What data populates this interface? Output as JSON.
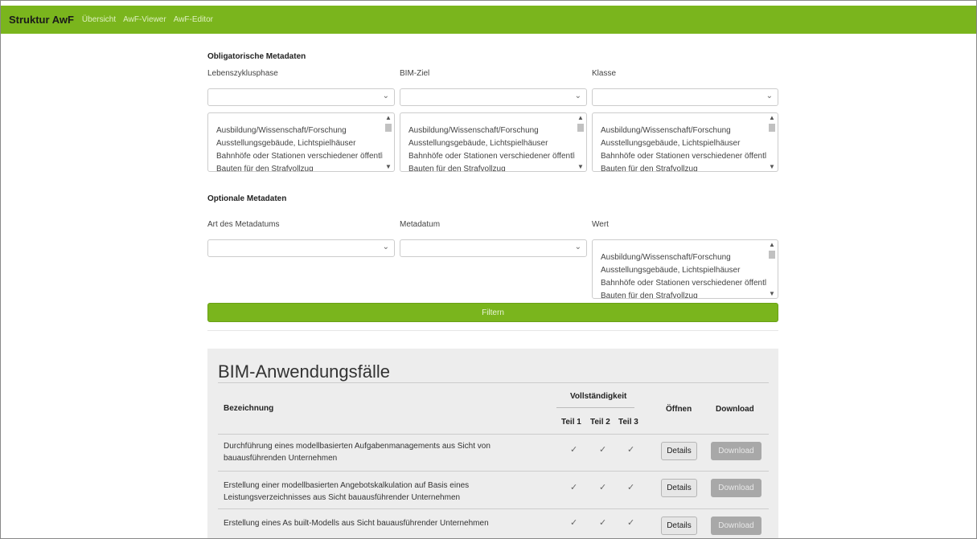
{
  "navbar": {
    "brand": "Struktur AwF",
    "links": [
      "Übersicht",
      "AwF-Viewer",
      "AwF-Editor"
    ]
  },
  "mandatory": {
    "heading": "Obligatorische Metadaten",
    "columns": [
      {
        "label": "Lebenszyklusphase",
        "select_value": ""
      },
      {
        "label": "BIM-Ziel",
        "select_value": ""
      },
      {
        "label": "Klasse",
        "select_value": ""
      }
    ]
  },
  "listbox_options": [
    "Ausbildung/Wissenschaft/Forschung",
    "Ausstellungsgebäude, Lichtspielhäuser",
    "Bahnhöfe oder Stationen verschiedener öffentlicher",
    "Bauten für den Strafvollzug"
  ],
  "optional": {
    "heading": "Optionale Metadaten",
    "columns": [
      {
        "label": "Art des Metadatums",
        "select_value": ""
      },
      {
        "label": "Metadatum",
        "select_value": ""
      },
      {
        "label": "Wert"
      }
    ]
  },
  "filter_button": "Filtern",
  "usecases": {
    "title": "BIM-Anwendungsfälle",
    "headers": {
      "name": "Bezeichnung",
      "completeness": "Vollständigkeit",
      "parts": [
        "Teil 1",
        "Teil 2",
        "Teil 3"
      ],
      "open": "Öffnen",
      "download": "Download"
    },
    "rows": [
      {
        "name": "Durchführung eines modellbasierten Aufgabenmanagements aus Sicht von bauausführenden Unternehmen",
        "checks": [
          "✓",
          "✓",
          "✓"
        ],
        "details": "Details",
        "download": "Download"
      },
      {
        "name": "Erstellung einer modellbasierten Angebotskalkulation auf Basis eines Leistungsverzeichnisses aus Sicht bauausführender Unternehmen",
        "checks": [
          "✓",
          "✓",
          "✓"
        ],
        "details": "Details",
        "download": "Download"
      },
      {
        "name": "Erstellung eines As built-Modells aus Sicht bauausführender Unternehmen",
        "checks": [
          "✓",
          "✓",
          "✓"
        ],
        "details": "Details",
        "download": "Download"
      }
    ]
  },
  "colors": {
    "accent": "#7ab51d",
    "panel_bg": "#ededed",
    "download_disabled": "#a8a8a8"
  },
  "icons": {
    "select_caret": "chevron-down-icon",
    "scroll_up": "scroll-up-arrow-icon",
    "scroll_down": "scroll-down-arrow-icon",
    "check": "check-icon"
  }
}
